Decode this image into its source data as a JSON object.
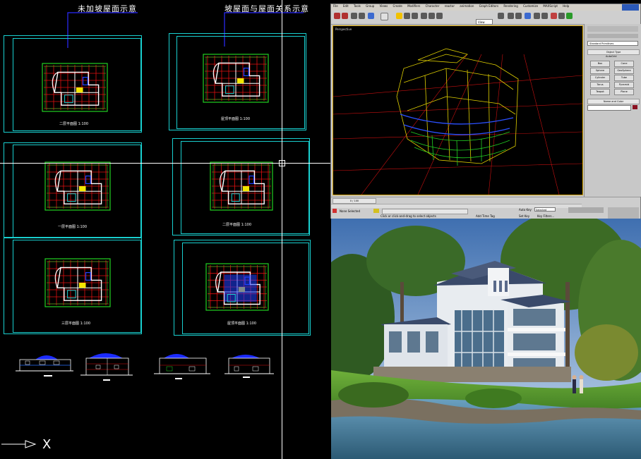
{
  "cad": {
    "title_left": "未加坡屋面示意",
    "title_right": "坡屋面与屋面关系示意",
    "plans": [
      {
        "label": "二层平面图 1:100"
      },
      {
        "label": "屋顶平面图 1:100"
      },
      {
        "label": "一层平面图 1:100"
      },
      {
        "label": "二层平面图 1:100"
      },
      {
        "label": "三层平面图 1:100"
      },
      {
        "label": "屋顶平面图 1:100"
      }
    ],
    "axis_label": "X",
    "colors": {
      "sheet_border": "#19d0d0",
      "grid_red": "#e01010",
      "grid_green": "#22d022",
      "walls_white": "#ffffff",
      "accent_blue": "#2040ff",
      "hatch_yellow": "#f2e600"
    }
  },
  "max": {
    "menu": [
      "File",
      "Edit",
      "Tools",
      "Group",
      "Views",
      "Create",
      "Modifiers",
      "Character",
      "reactor",
      "animation",
      "Graph Editors",
      "Rendering",
      "Customize",
      "MAXScript",
      "Help"
    ],
    "viewport_label": "Perspective",
    "view_dropdown": "View",
    "panel": {
      "object_name": "Standard Primitives",
      "object_type_header": "Object Type",
      "autogrid": "AutoGrid",
      "buttons": [
        "Box",
        "Cone",
        "Sphere",
        "GeoSphere",
        "Cylinder",
        "Tube",
        "Torus",
        "Pyramid",
        "Teapot",
        "Plane"
      ],
      "name_color_header": "Name and Color"
    },
    "status": {
      "frame": "0 / 100",
      "selection": "None Selected",
      "prompt": "Click or click-and-drag to select objects",
      "add_time_tag": "Add Time Tag",
      "autokey": "Auto Key",
      "setkey": "Set Key",
      "selected": "Selected",
      "key_filters": "Key Filters..."
    }
  },
  "render": {
    "scene": "villa rendering"
  }
}
